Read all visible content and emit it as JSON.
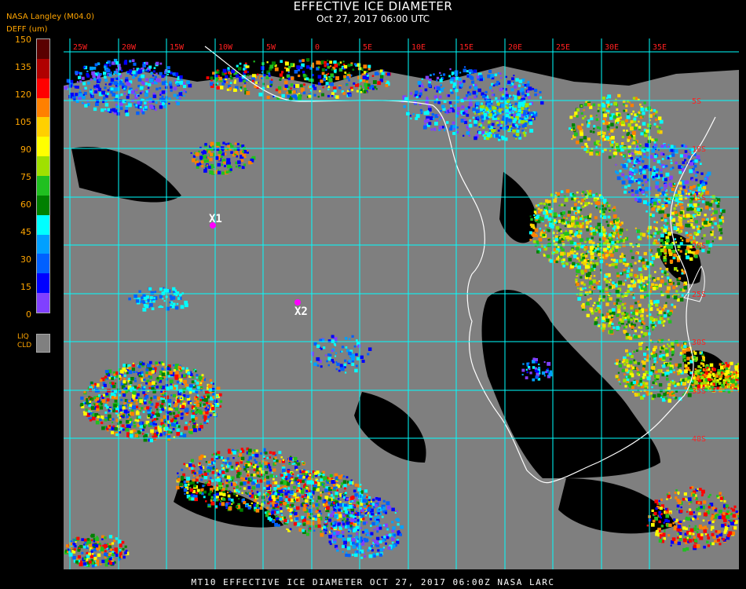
{
  "header": {
    "title": "EFFECTIVE ICE DIAMETER",
    "subtitle": "Oct 27, 2017 06:00 UTC",
    "org": "NASA Langley (M04.0)"
  },
  "legend": {
    "title": "DEFF (um)",
    "ticks": [
      "150",
      "135",
      "120",
      "105",
      "90",
      "75",
      "60",
      "45",
      "30",
      "15",
      "0"
    ],
    "colors": [
      "#5a0000",
      "#b00000",
      "#ff0000",
      "#ff8000",
      "#ffd000",
      "#ffff00",
      "#a0e000",
      "#20c020",
      "#008000",
      "#00ffff",
      "#00a0ff",
      "#0060ff",
      "#0000ff",
      "#8040ff"
    ],
    "liquid_label_1": "LIQ",
    "liquid_label_2": "CLD",
    "liquid_color": "#808080"
  },
  "map": {
    "grid_color": "#00ffff",
    "coast_color": "#ffffff",
    "lon_labels": [
      "25W",
      "20W",
      "15W",
      "10W",
      "5W",
      "0",
      "5E",
      "10E",
      "15E",
      "20E",
      "25E",
      "30E",
      "35E"
    ],
    "lat_labels": [
      "5S",
      "10S",
      "15S",
      "20S",
      "25S",
      "30S",
      "35S",
      "40S"
    ],
    "markers": [
      {
        "label": "X1",
        "color": "#ff00ff"
      },
      {
        "label": "X2",
        "color": "#ff00ff"
      }
    ]
  },
  "footer": {
    "text": "MT10  EFFECTIVE ICE DIAMETER  OCT 27, 2017 06:00Z  NASA LARC"
  }
}
